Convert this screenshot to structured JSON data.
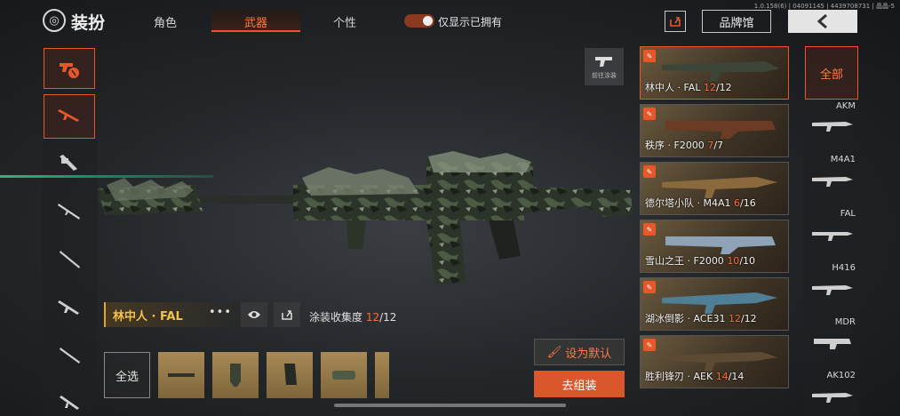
{
  "version": "1.0.158(6) | 04091145 | 4439708731 | 晶晶-5",
  "header": {
    "title": "装扮",
    "tabs": [
      {
        "label": "角色",
        "active": false
      },
      {
        "label": "武器",
        "active": true
      },
      {
        "label": "个性",
        "active": false
      }
    ],
    "toggle_label": "仅显示已拥有",
    "toggle_on": true,
    "brand_button": "品牌馆"
  },
  "left_categories": [
    "weapon-skins",
    "rifle",
    "grenade-launcher",
    "sniper",
    "sniper-2",
    "assault",
    "shotgun",
    "smg"
  ],
  "paint_button": "前往涂装",
  "current_skin": {
    "name": "林中人 · FAL",
    "collect_label": "涂装收集度",
    "collect_owned": "12",
    "collect_total": "/12"
  },
  "select_all": "全选",
  "set_default": "设为默认",
  "assemble": "去组装",
  "skins": [
    {
      "name": "林中人 · FAL",
      "owned": "12",
      "total": "/12",
      "active": true
    },
    {
      "name": "秩序 · F2000",
      "owned": "7",
      "total": "/7",
      "active": false
    },
    {
      "name": "德尔塔小队 · M4A1",
      "owned": "6",
      "total": "/16",
      "active": false
    },
    {
      "name": "雪山之王 · F2000",
      "owned": "10",
      "total": "/10",
      "active": false
    },
    {
      "name": "湖冰倒影 · ACE31",
      "owned": "12",
      "total": "/12",
      "active": false
    },
    {
      "name": "胜利锋刃 · AEK",
      "owned": "14",
      "total": "/14",
      "active": false
    }
  ],
  "right_categories": {
    "all_label": "全部",
    "items": [
      "AKM",
      "M4A1",
      "FAL",
      "H416",
      "MDR",
      "AK102"
    ]
  },
  "colors": {
    "accent": "#e8572a",
    "gold": "#f3c04a",
    "orange_text": "#ff6a3a"
  }
}
